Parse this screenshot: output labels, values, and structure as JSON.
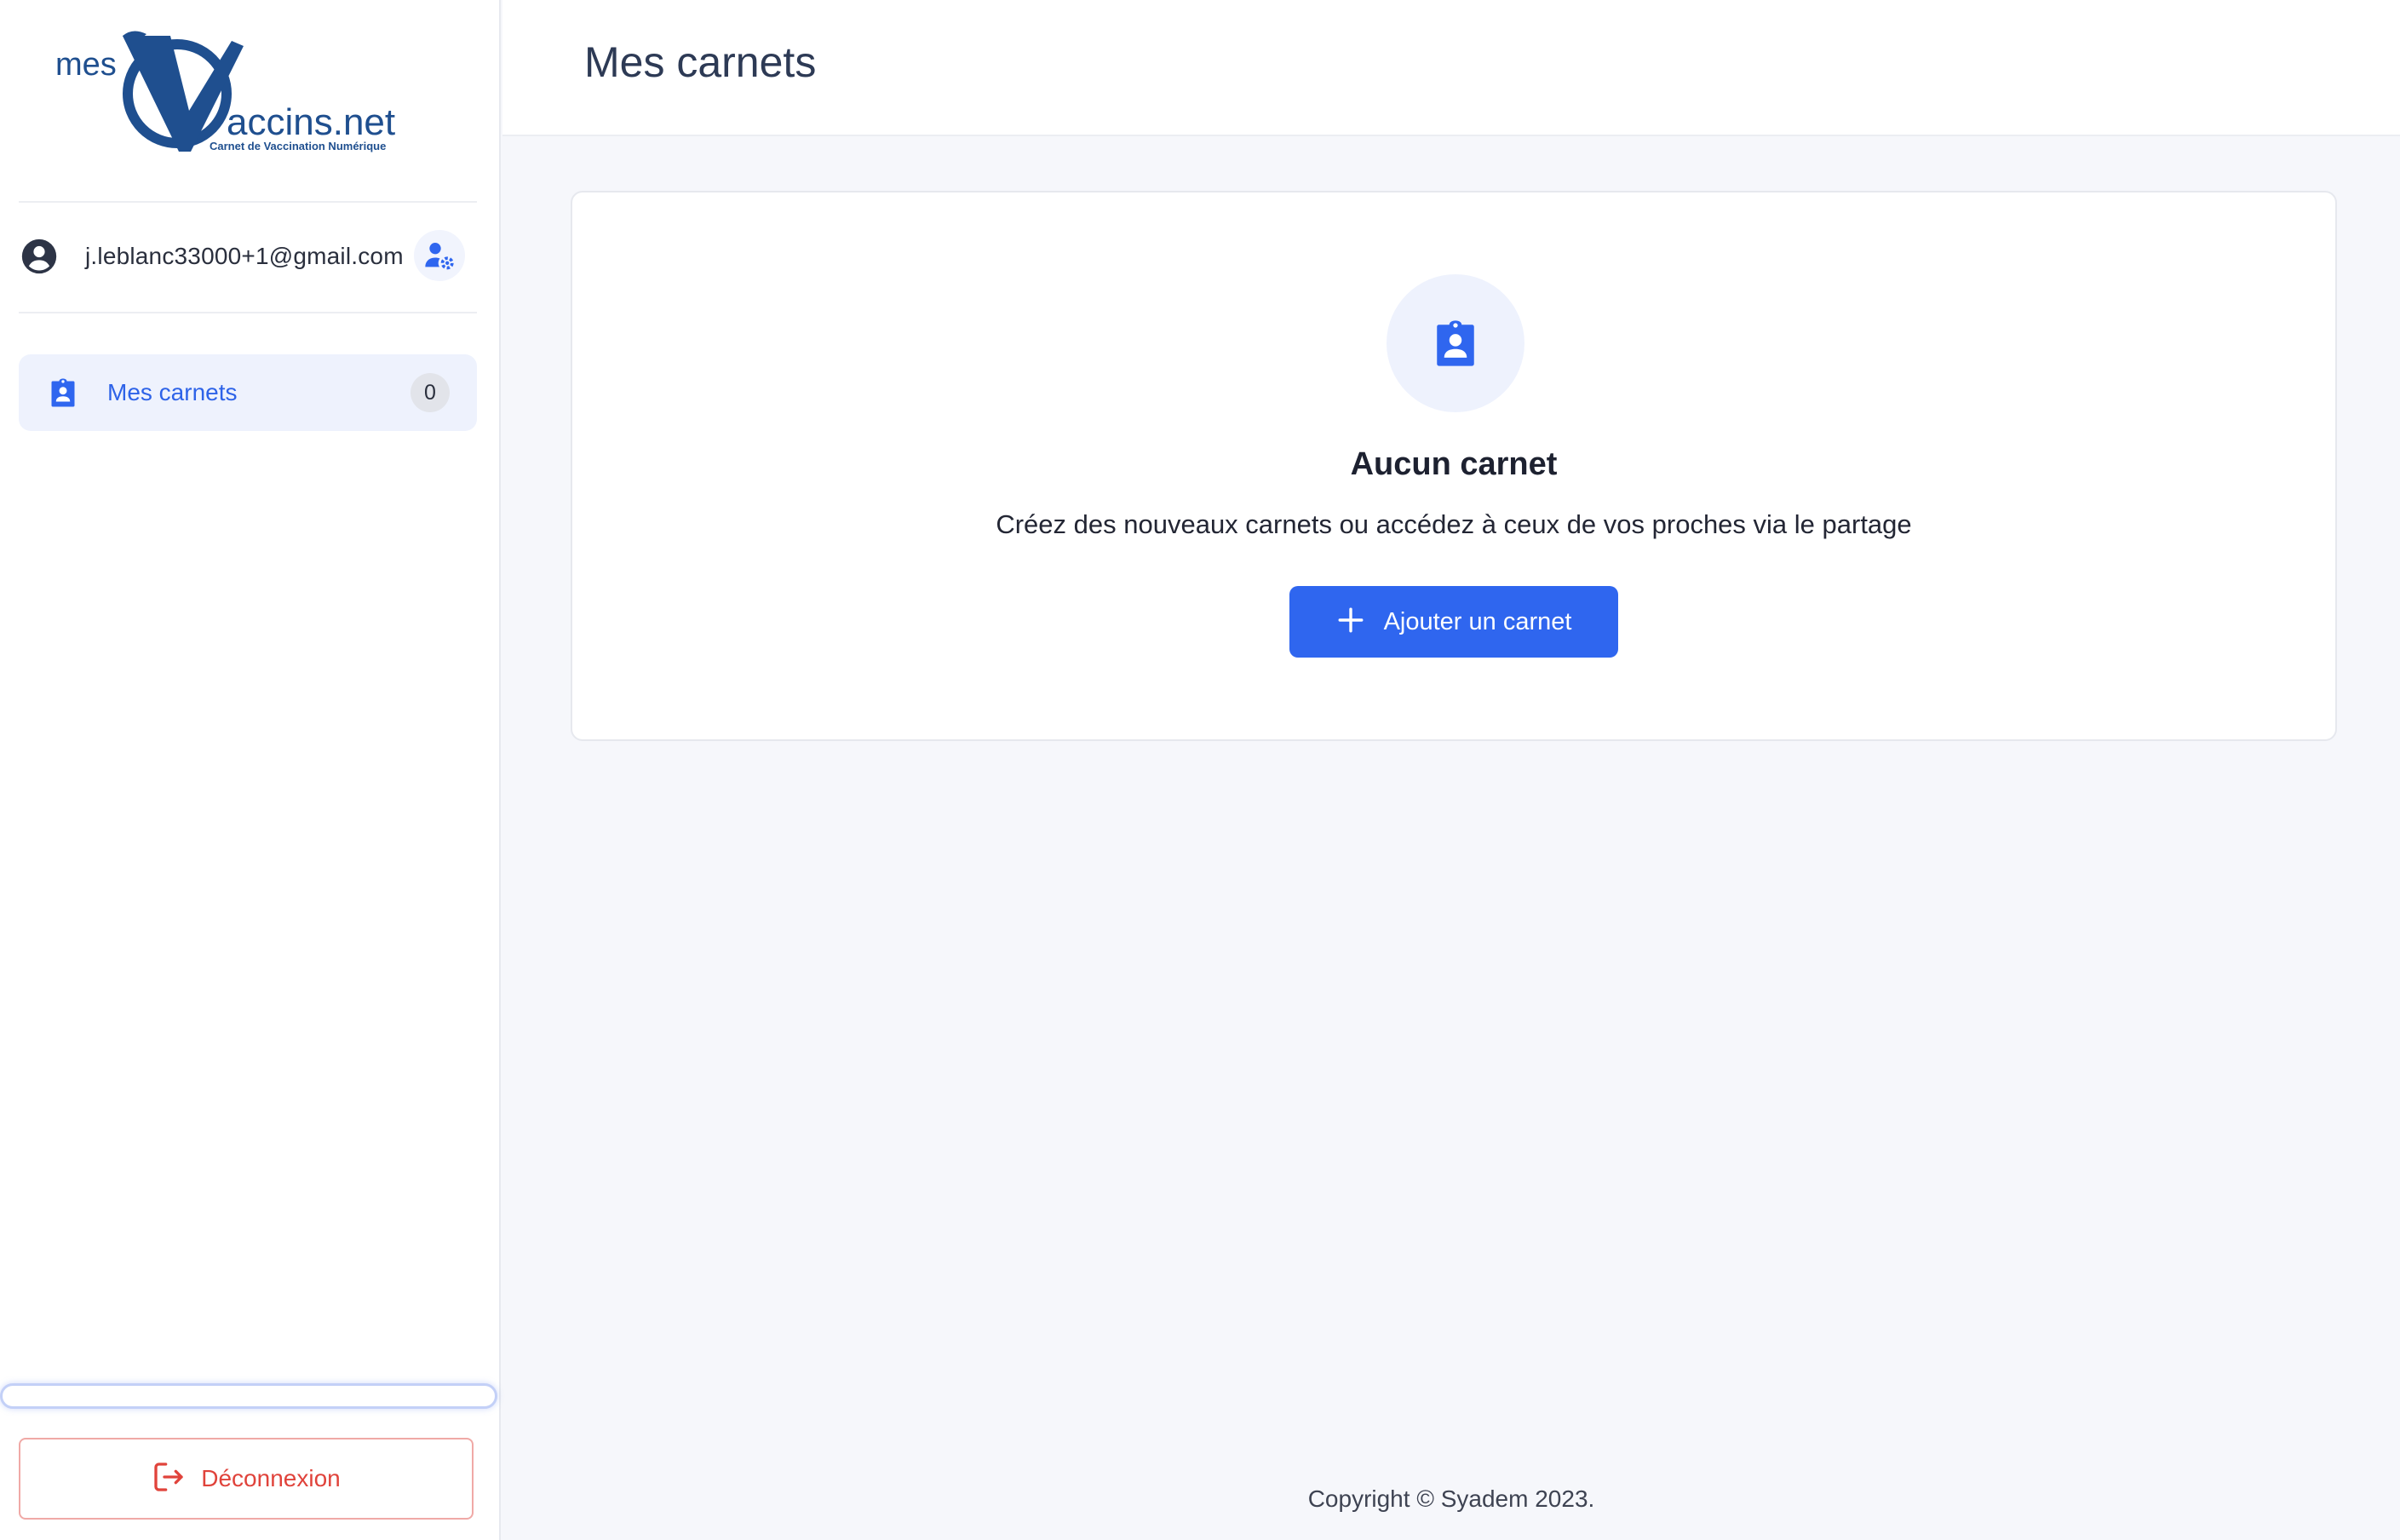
{
  "logo": {
    "word_mes": "mes",
    "word_accins": "accins.net",
    "tagline": "Carnet de Vaccination Numérique"
  },
  "user": {
    "email": "j.leblanc33000+1@gmail.com"
  },
  "sidebar": {
    "items": [
      {
        "label": "Mes carnets",
        "count": "0",
        "icon": "badge-icon"
      }
    ],
    "logout_label": "Déconnexion"
  },
  "header": {
    "title": "Mes carnets"
  },
  "empty_state": {
    "title": "Aucun carnet",
    "text": "Créez des nouveaux carnets ou accédez à ceux de vos proches via le partage",
    "button_label": "Ajouter un carnet"
  },
  "footer": {
    "text": "Copyright © Syadem 2023."
  },
  "colors": {
    "accent": "#2f66ef",
    "logo_blue": "#1f4f8f",
    "danger": "#e0433b",
    "nav_bg": "#eef2fd"
  }
}
